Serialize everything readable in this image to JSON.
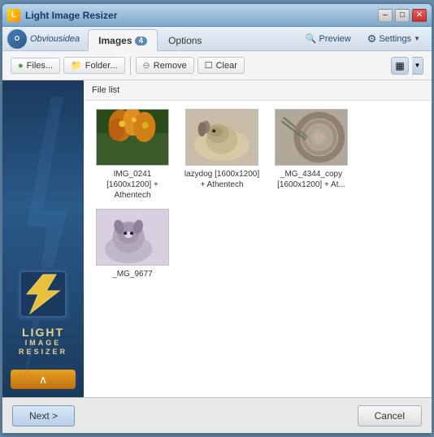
{
  "window": {
    "title": "Light Image Resizer",
    "controls": {
      "minimize": "–",
      "maximize": "□",
      "close": "✕"
    }
  },
  "menubar": {
    "logo_text": "Obviousidea",
    "tabs": [
      {
        "id": "images",
        "label": "Images",
        "badge": "4",
        "active": true
      },
      {
        "id": "options",
        "label": "Options",
        "active": false
      }
    ],
    "right_buttons": [
      {
        "id": "preview",
        "label": "Preview",
        "icon": "🔍"
      },
      {
        "id": "settings",
        "label": "Settings",
        "icon": "⚙"
      }
    ]
  },
  "toolbar": {
    "buttons": [
      {
        "id": "files",
        "label": "Files...",
        "icon": "+"
      },
      {
        "id": "folder",
        "label": "Folder...",
        "icon": "📁"
      },
      {
        "id": "remove",
        "label": "Remove",
        "icon": "⊖"
      },
      {
        "id": "clear",
        "label": "Clear",
        "icon": "☐"
      }
    ],
    "view_icon": "▦"
  },
  "file_list": {
    "header": "File list",
    "items": [
      {
        "id": "img1",
        "name": "IMG_0241",
        "label": "IMG_0241\n[1600x1200] +\nAthentech",
        "thumb_type": "flowers"
      },
      {
        "id": "img2",
        "name": "lazydog",
        "label": "lazydog [1600x1200]\n+ Athentech",
        "thumb_type": "dog"
      },
      {
        "id": "img3",
        "name": "_MG_4344_copy",
        "label": "_MG_4344_copy\n[1600x1200] + At...",
        "thumb_type": "rope"
      },
      {
        "id": "img4",
        "name": "_MG_9677",
        "label": "_MG_9677",
        "thumb_type": "cat"
      }
    ]
  },
  "sidebar": {
    "logo_line1": "LIGHT",
    "logo_line2": "IMAGE",
    "logo_line3": "RESIZER",
    "arrow_icon": "∧"
  },
  "footer": {
    "next_label": "Next >",
    "cancel_label": "Cancel"
  }
}
